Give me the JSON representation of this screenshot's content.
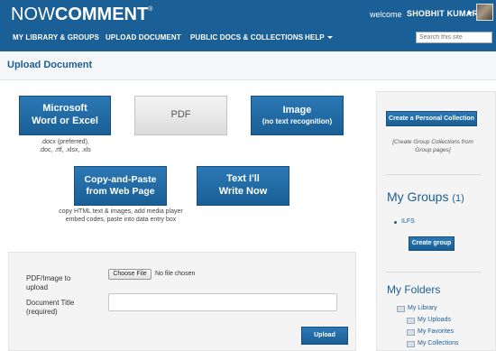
{
  "header": {
    "logo_now": "NOW",
    "logo_comment": "COMMENT",
    "logo_tm": "®",
    "welcome": "welcome",
    "username": "SHOBHIT KUMAR",
    "search_placeholder": "Search this site"
  },
  "nav": {
    "items": [
      {
        "label": "MY LIBRARY & GROUPS"
      },
      {
        "label": "UPLOAD DOCUMENT"
      },
      {
        "label": "PUBLIC DOCS & COLLECTIONS"
      },
      {
        "label": "HELP"
      }
    ]
  },
  "page": {
    "title": "Upload Document"
  },
  "upload_options": {
    "word": {
      "line1": "Microsoft",
      "line2": "Word or Excel",
      "hint1": ".docx (preferred),",
      "hint2": ".doc, .rtf, .xlsx, .xls"
    },
    "pdf": {
      "label": "PDF"
    },
    "image": {
      "line1": "Image",
      "line2": "(no text recognition)"
    },
    "copy_paste": {
      "line1": "Copy-and-Paste",
      "line2": "from Web Page",
      "hint1": "copy HTML text & images, add media player",
      "hint2": "embed codes, paste into data entry box"
    },
    "text": {
      "line1": "Text I'll",
      "line2": "Write Now"
    }
  },
  "form": {
    "file_label_1": "PDF/Image to",
    "file_label_2": "upload",
    "choose_file": "Choose File",
    "no_file": "No file chosen",
    "title_label_1": "Document Title",
    "title_label_2": "(required)",
    "title_value": "",
    "upload_button": "Upload"
  },
  "sidebar": {
    "create_collection": "Create a Personal Collection",
    "note_1": "[Create Group Collections from",
    "note_2": "Group pages]",
    "groups_heading": "My Groups",
    "groups_count": "(1)",
    "groups": [
      {
        "label": "ILFS"
      }
    ],
    "create_group": "Create group",
    "folders_heading": "My Folders",
    "folders": [
      {
        "label": "My Library"
      },
      {
        "label": "My Uploads"
      },
      {
        "label": "My Favorites"
      },
      {
        "label": "My Collections"
      }
    ]
  },
  "colors": {
    "brand": "#1a5f96",
    "background": "#ffffff"
  }
}
